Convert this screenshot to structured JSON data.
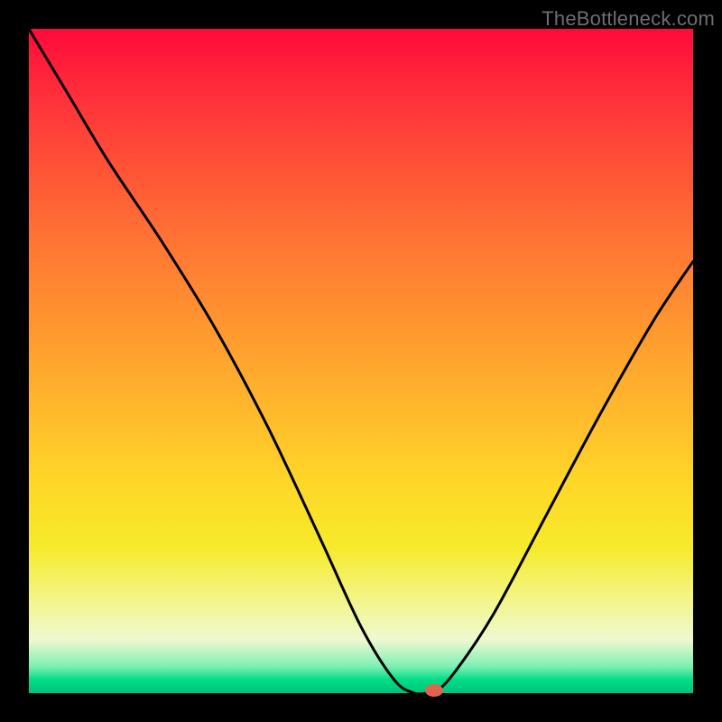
{
  "watermark": "TheBottleneck.com",
  "chart_data": {
    "type": "line",
    "title": "",
    "xlabel": "",
    "ylabel": "",
    "xlim": [
      0,
      100
    ],
    "ylim": [
      0,
      100
    ],
    "series": [
      {
        "name": "bottleneck-curve",
        "x": [
          0,
          6,
          12,
          20,
          28,
          36,
          44,
          50,
          55,
          58,
          60,
          61,
          64,
          70,
          78,
          86,
          94,
          100
        ],
        "values": [
          100,
          90,
          80,
          68,
          55,
          40,
          23,
          10,
          2,
          0,
          0,
          0,
          3,
          12,
          27,
          42,
          56,
          65
        ]
      }
    ],
    "marker": {
      "x": 61,
      "y": 0
    },
    "background_gradient": {
      "stops": [
        {
          "pos": 0,
          "color": "#ff0a3a"
        },
        {
          "pos": 22,
          "color": "#ff5636"
        },
        {
          "pos": 46,
          "color": "#ff9a2f"
        },
        {
          "pos": 68,
          "color": "#ffd628"
        },
        {
          "pos": 86,
          "color": "#f3f58a"
        },
        {
          "pos": 96,
          "color": "#7cf0b2"
        },
        {
          "pos": 100,
          "color": "#00c37b"
        }
      ]
    }
  }
}
